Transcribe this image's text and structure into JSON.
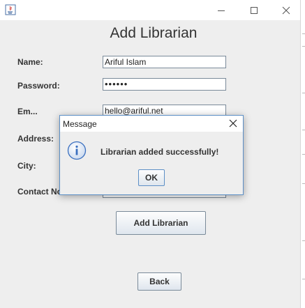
{
  "window": {
    "minimize_glyph": "—",
    "maximize_glyph": "☐",
    "close_glyph": "✕"
  },
  "form": {
    "heading": "Add Librarian",
    "name_label": "Name:",
    "name_value": "Ariful Islam",
    "password_label": "Password:",
    "password_value": "••••••",
    "email_label": "Em...",
    "email_value": "hello@ariful.net",
    "address_label": "Address:",
    "city_label": "City:",
    "contact_label": "Contact No",
    "add_button": "Add Librarian",
    "back_button": "Back"
  },
  "dialog": {
    "title": "Message",
    "message": "Librarian added successfully!",
    "ok_button": "OK",
    "icon": "info-icon"
  },
  "colors": {
    "window_bg": "#eeeeee",
    "titlebar_bg": "#ffffff",
    "dialog_border": "#5c8fc6",
    "info_icon": "#3a6fbf"
  }
}
